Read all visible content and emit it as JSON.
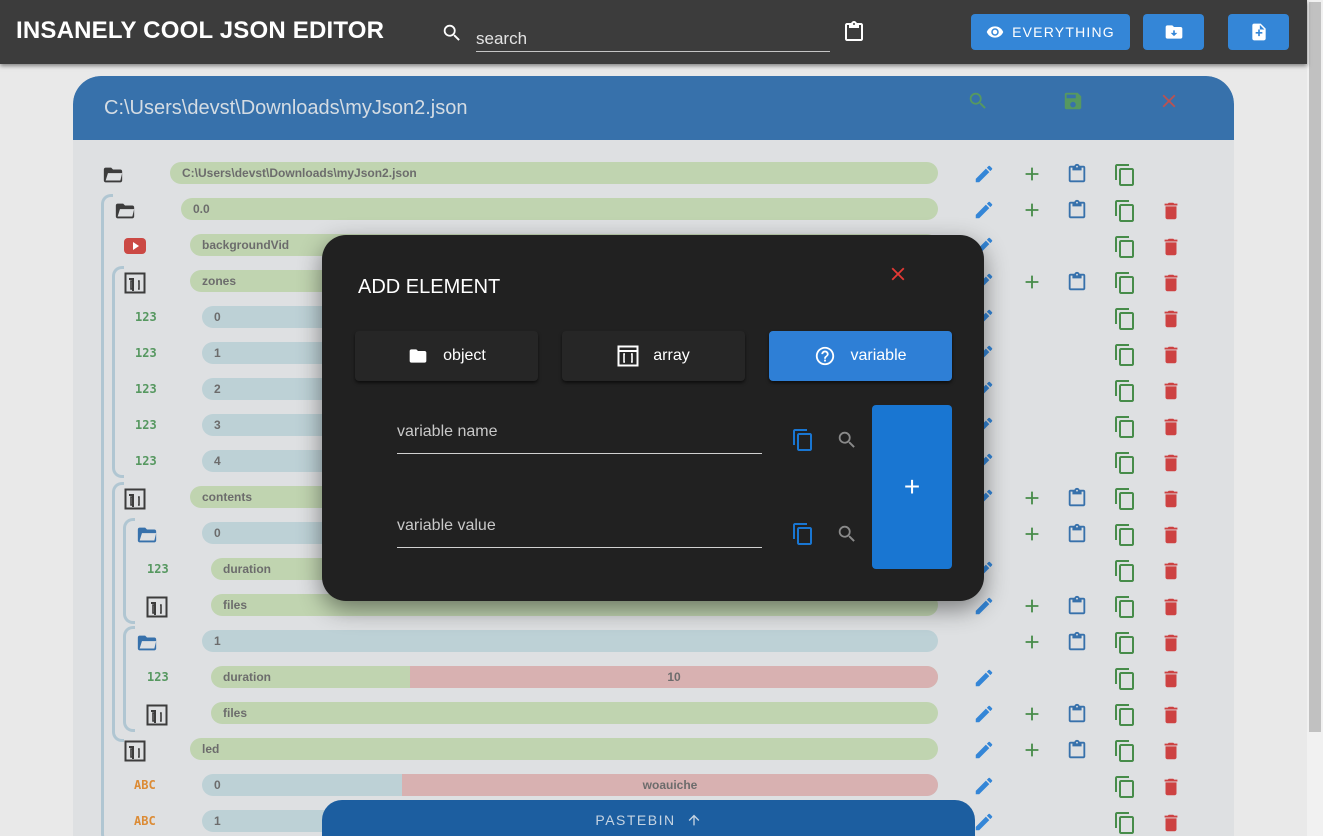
{
  "app": {
    "title": "INSANELY COOL JSON EDITOR"
  },
  "search": {
    "placeholder": "search"
  },
  "toolbar": {
    "everything_label": "EVERYTHING"
  },
  "file": {
    "path": "C:\\Users\\devst\\Downloads\\myJson2.json"
  },
  "tree": {
    "root": "C:\\Users\\devst\\Downloads\\myJson2.json",
    "rows": [
      {
        "key": "0.0"
      },
      {
        "key": "backgroundVid"
      },
      {
        "key": "zones"
      },
      {
        "key": "0"
      },
      {
        "key": "1"
      },
      {
        "key": "2"
      },
      {
        "key": "3"
      },
      {
        "key": "4"
      },
      {
        "key": "contents"
      },
      {
        "key": "0"
      },
      {
        "key": "duration"
      },
      {
        "key": "files"
      },
      {
        "key": "1"
      },
      {
        "key": "duration",
        "value": "10"
      },
      {
        "key": "files"
      },
      {
        "key": "led"
      },
      {
        "key": "0",
        "value": "woauiche"
      },
      {
        "key": "1"
      }
    ],
    "type_labels": {
      "number": "123",
      "string": "ABC"
    }
  },
  "dialog": {
    "title": "ADD ELEMENT",
    "types": {
      "object": "object",
      "array": "array",
      "variable": "variable"
    },
    "selected_type": "variable",
    "name_placeholder": "variable name",
    "value_placeholder": "variable value",
    "add_label": "+"
  },
  "pastebin": {
    "label": "PASTEBIN"
  },
  "colors": {
    "primary": "#1976d2",
    "topbar": "#212121",
    "dialog": "#212121",
    "delete": "#c62828",
    "add": "#2e7d32",
    "close": "#e53935"
  }
}
